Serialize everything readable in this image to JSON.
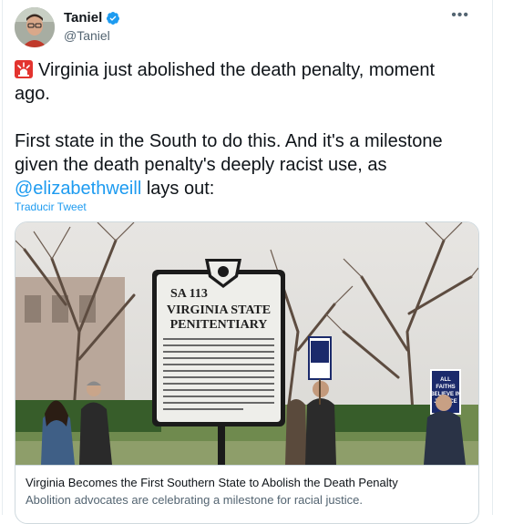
{
  "tweet": {
    "author": {
      "display_name": "Taniel",
      "handle": "@Taniel",
      "verified": true
    },
    "more_icon": "more-horizontal-icon",
    "paragraph_1": "Virginia just abolished the death penalty, moment ago.",
    "paragraph_2_prefix": "First state in the South to do this. And it's a milestone given the death penalty's deeply racist use, as ",
    "mention": "@elizabethweill",
    "paragraph_2_suffix": " lays out:",
    "siren_icon": "siren-icon",
    "translate_label": "Traducir Tweet"
  },
  "link_card": {
    "title": "Virginia Becomes the First Southern State to Abolish the Death Penalty",
    "description": "Abolition advocates are celebrating a milestone for racial justice.",
    "image": {
      "marker_id": "SA 113",
      "marker_title_1": "VIRGINIA STATE",
      "marker_title_2": "PENITENTIARY",
      "protest_sign": [
        "ALL",
        "FAITHS",
        "BELIEVE IN",
        "JUSTICE"
      ]
    }
  },
  "colors": {
    "link": "#1d9bf0",
    "verified": "#1d9bf0",
    "secondary_text": "#536471",
    "border": "#cfd9de"
  }
}
